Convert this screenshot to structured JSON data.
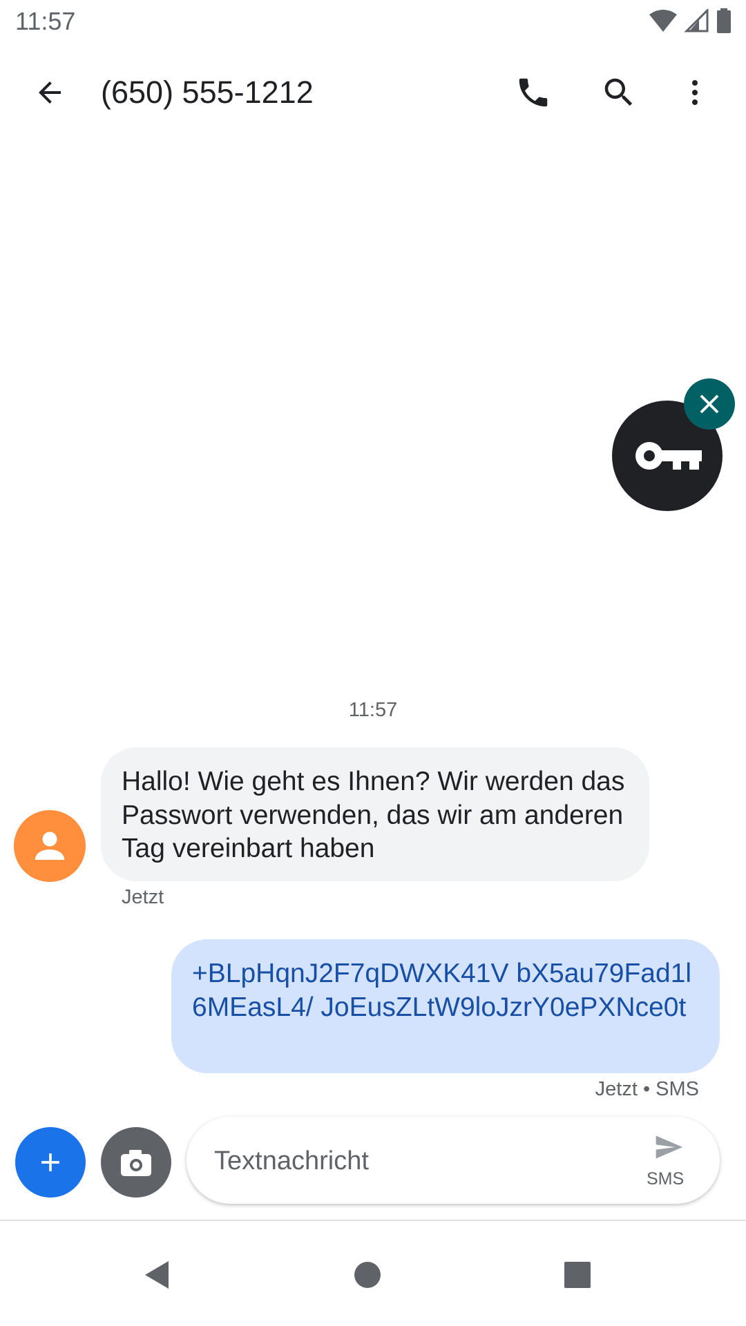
{
  "status_bar": {
    "time": "11:57"
  },
  "app_bar": {
    "title": "(650) 555-1212"
  },
  "conversation": {
    "timestamp": "11:57",
    "messages": [
      {
        "direction": "incoming",
        "text": "Hallo! Wie geht es Ihnen? Wir werden das Passwort verwenden, das wir am anderen Tag vereinbart haben",
        "meta": "Jetzt"
      },
      {
        "direction": "outgoing",
        "text": "+BLpHqnJ2F7qDWXK41V bX5au79Fad1l6MEasL4/ JoEusZLtW9loJzrY0ePXNce0t",
        "meta": "Jetzt • SMS"
      }
    ]
  },
  "compose": {
    "placeholder": "Textnachricht",
    "send_label": "SMS"
  },
  "colors": {
    "accent": "#1a73e8",
    "incoming_bubble": "#f1f3f4",
    "outgoing_bubble": "#d3e3fd",
    "outgoing_text": "#174ea6",
    "avatar": "#ff8f3d",
    "key_close": "#006064"
  },
  "icons": [
    "back-arrow-icon",
    "phone-icon",
    "search-icon",
    "more-vert-icon",
    "key-icon",
    "close-icon",
    "add-icon",
    "camera-icon",
    "send-icon",
    "nav-back-icon",
    "nav-home-icon",
    "nav-recents-icon"
  ]
}
